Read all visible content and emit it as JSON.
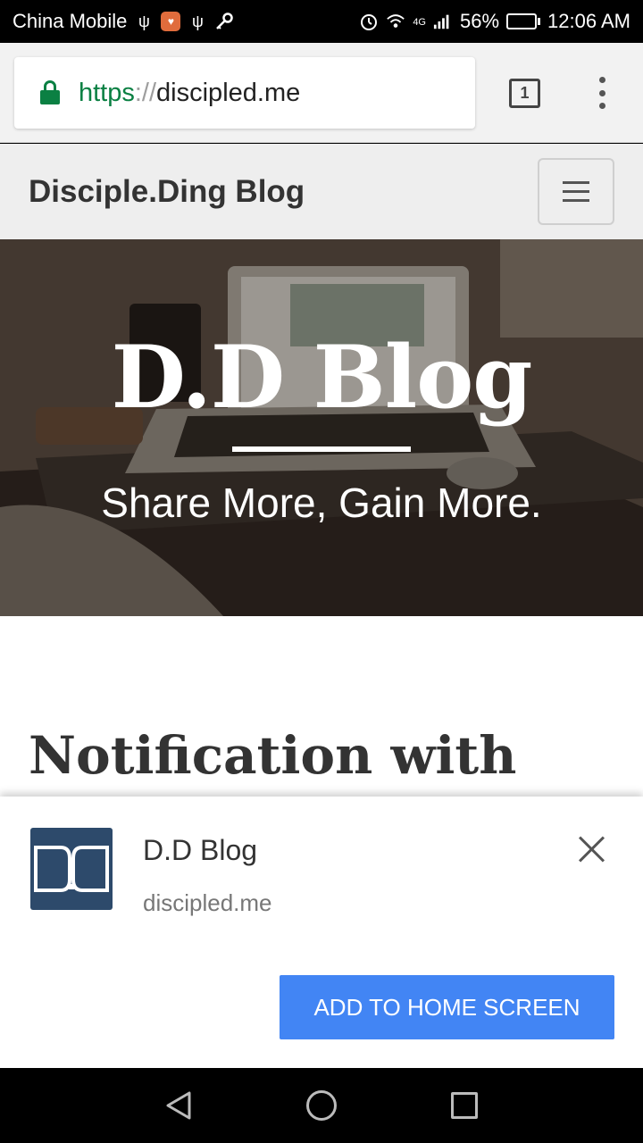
{
  "status_bar": {
    "carrier": "China Mobile",
    "network": "4G",
    "battery_percent": "56%",
    "battery_level": 0.56,
    "time": "12:06 AM",
    "icons": [
      "usb-icon",
      "app-notification-icon",
      "usb-icon",
      "key-icon",
      "alarm-icon",
      "wifi-icon",
      "signal-icon",
      "battery-charging-icon"
    ]
  },
  "browser": {
    "url_scheme": "https",
    "url_separator": "://",
    "url_host": "discipled.me",
    "tab_count": "1"
  },
  "site": {
    "brand": "Disciple.Ding Blog"
  },
  "hero": {
    "title": "D.D Blog",
    "subtitle": "Share More, Gain More."
  },
  "post": {
    "title": "Notification with"
  },
  "add_to_home": {
    "app_name": "D.D Blog",
    "domain": "discipled.me",
    "button_label": "ADD TO HOME SCREEN"
  },
  "colors": {
    "secure_green": "#0b8043",
    "accent_blue": "#4285f4",
    "app_icon_bg": "#2d4a6b"
  }
}
